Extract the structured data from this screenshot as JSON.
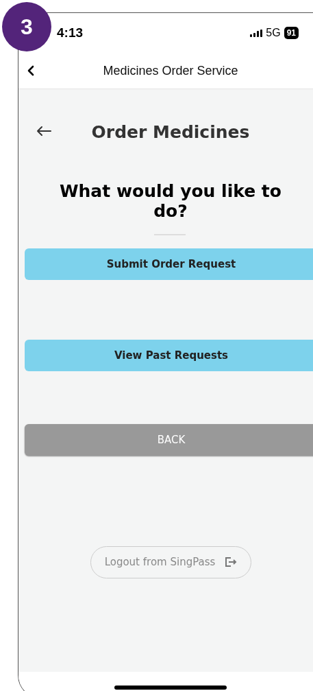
{
  "step_badge": "3",
  "status_bar": {
    "time": "4:13",
    "network": "5G",
    "battery": "91"
  },
  "nav_bar": {
    "title": "Medicines Order Service"
  },
  "page": {
    "title": "Order Medicines",
    "question": "What would you like to do?"
  },
  "actions": [
    {
      "label": "Submit Order Request",
      "kind": "primary"
    },
    {
      "label": "View Past Requests",
      "kind": "primary"
    },
    {
      "label": "BACK",
      "kind": "secondary"
    }
  ],
  "logout": {
    "label": "Logout from SingPass"
  }
}
